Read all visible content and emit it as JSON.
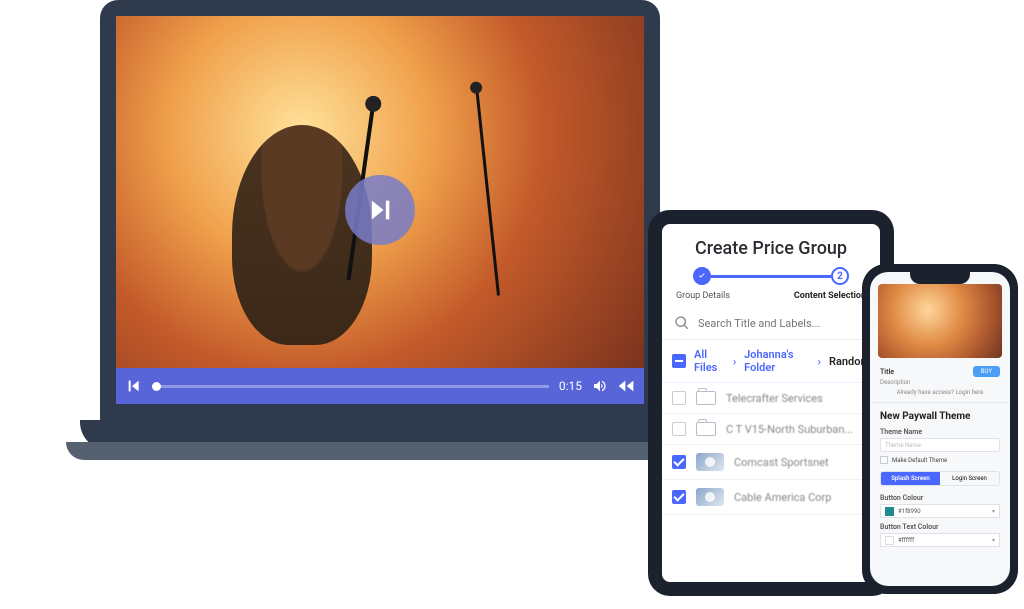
{
  "video": {
    "time": "0:15"
  },
  "tablet": {
    "title": "Create Price Group",
    "step2_number": "2",
    "step1_label": "Group Details",
    "step2_label": "Content Selection",
    "search_placeholder": "Search Title and Labels...",
    "crumb1": "All Files",
    "crumb2": "Johanna's Folder",
    "crumb3": "Random",
    "items": [
      {
        "label": "Telecrafter Services"
      },
      {
        "label": "C T V15-North Suburban..."
      },
      {
        "label": "Comcast Sportsnet"
      },
      {
        "label": "Cable America Corp"
      }
    ]
  },
  "phone": {
    "title_label": "Title",
    "desc_label": "Description",
    "buy": "BUY",
    "note": "Already have access? Login here",
    "heading": "New Paywall Theme",
    "theme_name_label": "Theme Name",
    "theme_name_placeholder": "Theme Name",
    "default_label": "Make Default Theme",
    "tab_splash": "Splash Screen",
    "tab_login": "Login Screen",
    "btn_colour_label": "Button Colour",
    "btn_colour_value": "#1f8990",
    "btn_text_colour_label": "Button Text Colour",
    "btn_text_colour_value": "#ffffff"
  }
}
